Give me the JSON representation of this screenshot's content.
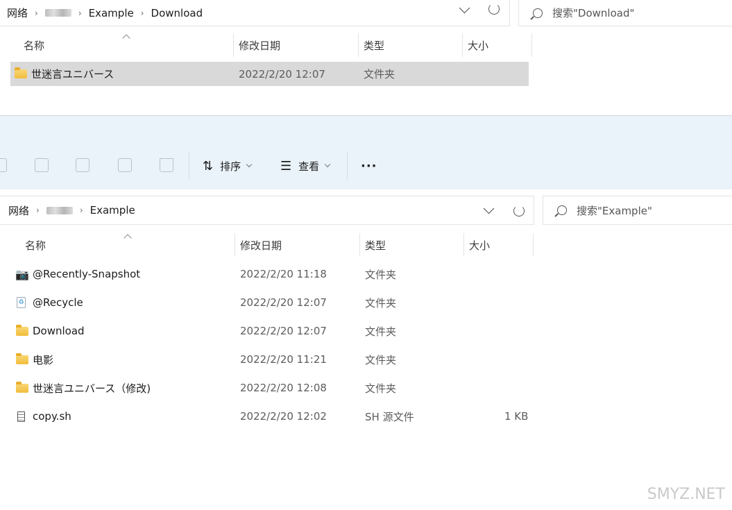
{
  "top_window": {
    "breadcrumb": [
      "网络",
      "Example",
      "Download"
    ],
    "search_placeholder": "搜索\"Download\"",
    "columns": {
      "name": "名称",
      "date": "修改日期",
      "type": "类型",
      "size": "大小"
    },
    "rows": [
      {
        "name": "世迷言ユニバース",
        "date": "2022/2/20 12:07",
        "type": "文件夹",
        "size": ""
      }
    ]
  },
  "toolbar": {
    "sort_label": "排序",
    "view_label": "查看",
    "more_label": "···"
  },
  "bottom_window": {
    "breadcrumb": [
      "网络",
      "Example"
    ],
    "search_placeholder": "搜索\"Example\"",
    "columns": {
      "name": "名称",
      "date": "修改日期",
      "type": "类型",
      "size": "大小"
    },
    "rows": [
      {
        "name": "@Recently-Snapshot",
        "date": "2022/2/20 11:18",
        "type": "文件夹",
        "size": "",
        "icon": "camera-icon"
      },
      {
        "name": "@Recycle",
        "date": "2022/2/20 12:07",
        "type": "文件夹",
        "size": "",
        "icon": "recycle-bin-icon"
      },
      {
        "name": "Download",
        "date": "2022/2/20 12:07",
        "type": "文件夹",
        "size": "",
        "icon": "folder-icon"
      },
      {
        "name": "电影",
        "date": "2022/2/20 11:21",
        "type": "文件夹",
        "size": "",
        "icon": "folder-icon"
      },
      {
        "name": "世迷言ユニバース（修改)",
        "date": "2022/2/20 12:08",
        "type": "文件夹",
        "size": "",
        "icon": "folder-icon"
      },
      {
        "name": "copy.sh",
        "date": "2022/2/20 12:02",
        "type": "SH 源文件",
        "size": "1 KB",
        "icon": "script-file-icon"
      }
    ]
  },
  "watermark": "SMYZ.NET"
}
